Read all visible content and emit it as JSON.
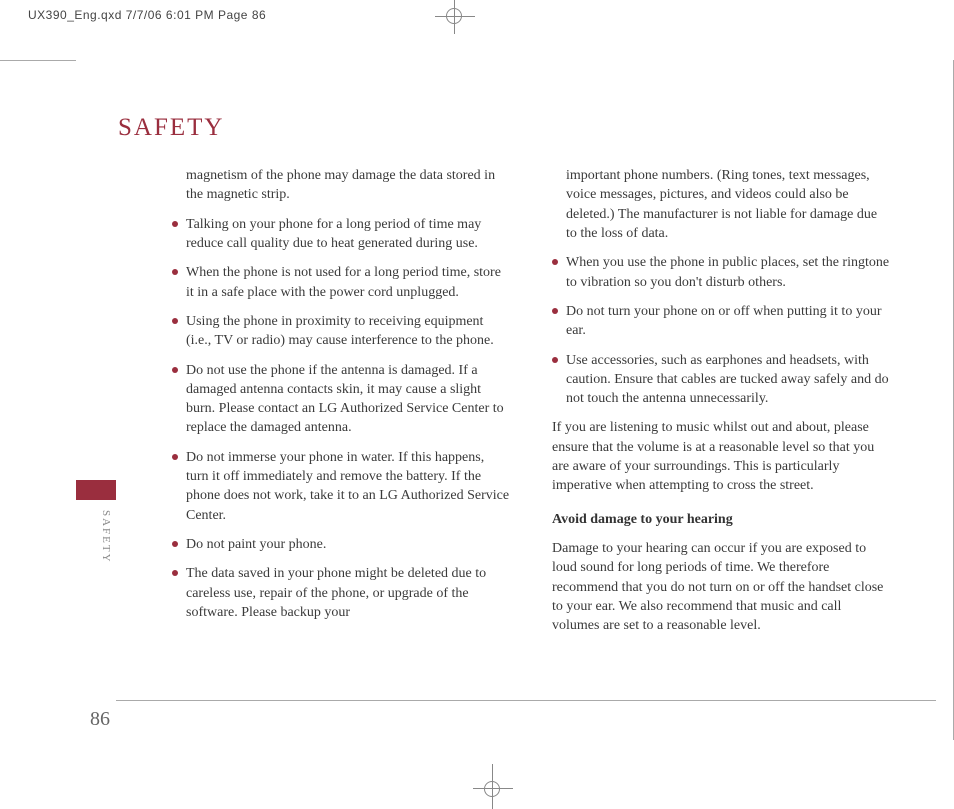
{
  "printHeader": "UX390_Eng.qxd  7/7/06  6:01 PM  Page 86",
  "sectionTitle": "SAFETY",
  "sideLabel": "SAFETY",
  "pageNumber": "86",
  "leftColumn": {
    "intro": "magnetism of the phone may damage the data stored in the magnetic strip.",
    "bullets": [
      "Talking on your phone for a long period of time may reduce call quality due to heat generated during use.",
      "When the phone is not used for a long period time, store it in a safe place with the power cord unplugged.",
      "Using the phone in proximity to receiving equipment (i.e., TV or radio) may cause interference to the phone.",
      "Do not use the phone if the antenna is damaged. If a damaged antenna contacts skin, it may cause a slight burn. Please contact an LG Authorized Service Center to replace the damaged antenna.",
      "Do not immerse your phone in water. If this happens, turn it off immediately and remove the battery. If the phone does not work, take it to an LG Authorized Service Center.",
      "Do not paint your phone.",
      "The data saved in your phone might be deleted due to careless use, repair of the phone, or upgrade of the software. Please backup your"
    ]
  },
  "rightColumn": {
    "intro": "important phone numbers. (Ring tones, text messages, voice messages, pictures, and videos could also be deleted.) The manufacturer is not liable for damage due to the loss of data.",
    "bullets": [
      "When you use the phone in public places, set the ringtone to vibration so you don't disturb others.",
      "Do not turn your phone on or off when putting it to your ear.",
      "Use accessories, such as earphones and headsets, with caution. Ensure that cables are tucked away safely and do not touch the antenna unnecessarily."
    ],
    "para1": "If you are listening to music whilst out and about, please ensure that the volume is at a reasonable level so that you are aware of your surroundings. This is particularly imperative when attempting to cross the street.",
    "subhead": "Avoid damage to your hearing",
    "para2": "Damage to your hearing can occur if you are exposed to loud sound for long periods of time. We therefore recommend that you do not turn on or off the handset close to your ear. We also recommend that music and call volumes are set to a reasonable level."
  }
}
